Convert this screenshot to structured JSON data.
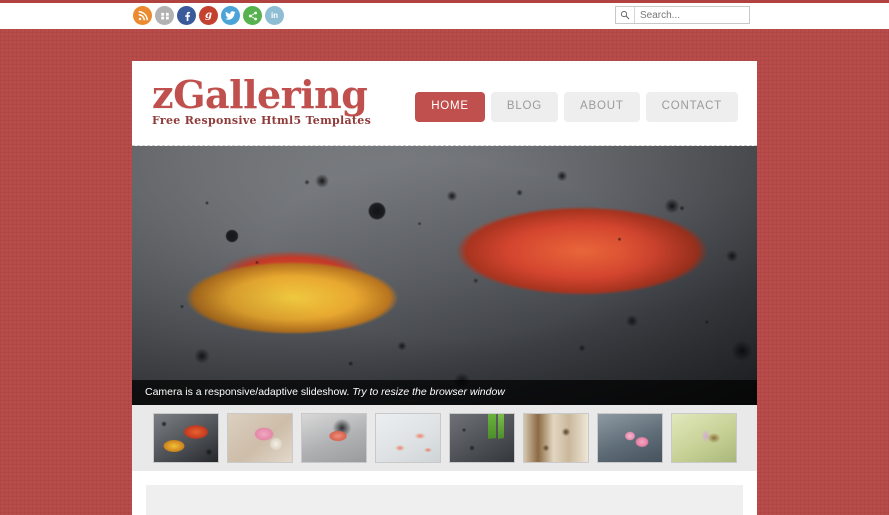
{
  "topbar": {
    "social_links": [
      {
        "name": "rss",
        "label": "RSS",
        "glyph": "◔",
        "color": "#eb8a2e"
      },
      {
        "name": "flickr",
        "label": "Flickr",
        "glyph": "❖",
        "color": "#b2b2b2"
      },
      {
        "name": "facebook",
        "label": "Facebook",
        "glyph": "f",
        "color": "#3b5a9b"
      },
      {
        "name": "googleplus",
        "label": "Google+",
        "glyph": "g",
        "color": "#c4402f"
      },
      {
        "name": "twitter",
        "label": "Twitter",
        "glyph": "ᵗ",
        "color": "#4ba3d8"
      },
      {
        "name": "share",
        "label": "Share",
        "glyph": "≪",
        "color": "#56b24f"
      },
      {
        "name": "linkedin",
        "label": "LinkedIn",
        "glyph": "in",
        "color": "#8ebdd4"
      }
    ],
    "search": {
      "placeholder": "Search...",
      "value": "",
      "icon": "search-icon"
    }
  },
  "header": {
    "logo": {
      "title": "zGallering",
      "tagline": "Free Responsive Html5 Templates"
    },
    "nav": [
      {
        "label": "HOME",
        "active": true
      },
      {
        "label": "BLOG",
        "active": false
      },
      {
        "label": "ABOUT",
        "active": false
      },
      {
        "label": "CONTACT",
        "active": false
      }
    ]
  },
  "slideshow": {
    "caption_plain": "Camera is a responsive/adaptive slideshow. ",
    "caption_italic": "Try to resize the browser window",
    "thumbnails": [
      {
        "name": "thumb-leaves-water",
        "alt": "Autumn leaves on wet dark surface",
        "active": true
      },
      {
        "name": "thumb-pink-flower",
        "alt": "Pink flower with wooden spoon",
        "active": false
      },
      {
        "name": "thumb-grey-droplets",
        "alt": "Pink petal on grey droplets",
        "active": false
      },
      {
        "name": "thumb-poppy-glass",
        "alt": "Red poppies behind frosted glass",
        "active": false
      },
      {
        "name": "thumb-bamboo-rain",
        "alt": "Green bamboo in the rain",
        "active": false
      },
      {
        "name": "thumb-spices-wood",
        "alt": "Star anise spices on wood",
        "active": false
      },
      {
        "name": "thumb-water-lily",
        "alt": "Pink water lilies",
        "active": false
      },
      {
        "name": "thumb-bee-flower",
        "alt": "Bee on a purple flower",
        "active": false
      }
    ]
  },
  "colors": {
    "brand_red": "#c0504d",
    "page_background": "#b94b4b",
    "nav_inactive_bg": "#eeeeee",
    "thumbstrip_bg": "#e9e9e9"
  }
}
